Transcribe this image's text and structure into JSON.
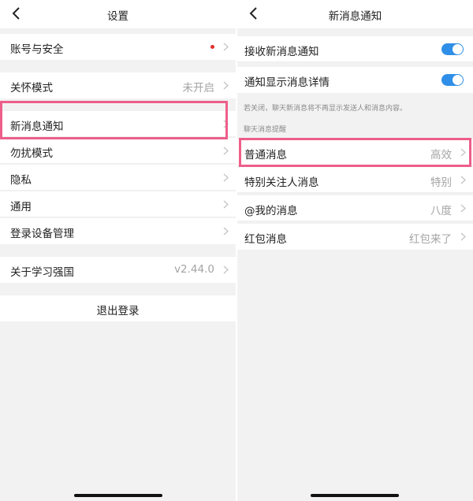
{
  "left": {
    "title": "设置",
    "rows": [
      {
        "label": "账号与安全"
      },
      {
        "label": "关怀模式",
        "value": "未开启"
      },
      {
        "label": "新消息通知"
      },
      {
        "label": "勿扰模式"
      },
      {
        "label": "隐私"
      },
      {
        "label": "通用"
      },
      {
        "label": "登录设备管理"
      },
      {
        "label": "关于学习强国",
        "value": "v2.44.0"
      }
    ],
    "logout_label": "退出登录"
  },
  "right": {
    "title": "新消息通知",
    "toggles": [
      {
        "label": "接收新消息通知",
        "on": true
      },
      {
        "label": "通知显示消息详情",
        "on": true
      }
    ],
    "note": "若关闭，聊天新消息将不再显示发送人和消息内容。",
    "section_title": "聊天消息提醒",
    "rows": [
      {
        "label": "普通消息",
        "value": "高效"
      },
      {
        "label": "特别关注人消息",
        "value": "特别"
      },
      {
        "label": "@我的消息",
        "value": "八度"
      },
      {
        "label": "红包消息",
        "value": "红包来了"
      }
    ]
  },
  "colors": {
    "highlight": "#ee5e8a",
    "toggle_on": "#2f8fe8",
    "badge_dot": "#e0302c",
    "background": "#f2f2f3"
  },
  "icons": [
    "back-arrow-icon",
    "chevron-right-icon",
    "notification-dot-icon"
  ]
}
